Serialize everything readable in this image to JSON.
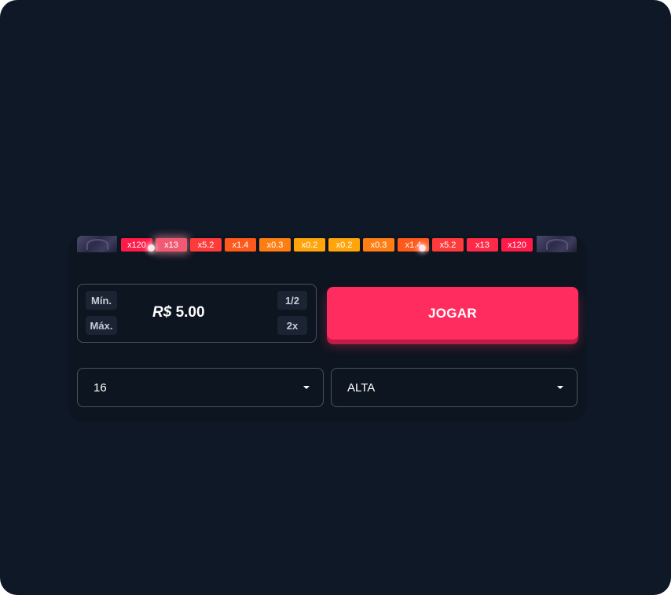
{
  "multipliers": [
    {
      "label": "x120",
      "color": "#ff1a48"
    },
    {
      "label": "x13",
      "color": "#f25a74"
    },
    {
      "label": "x5.2",
      "color": "#ff3a3a"
    },
    {
      "label": "x1.4",
      "color": "#ff5a1c"
    },
    {
      "label": "x0.3",
      "color": "#ff7e14"
    },
    {
      "label": "x0.2",
      "color": "#ffa40a"
    },
    {
      "label": "x0.2",
      "color": "#ffa40a"
    },
    {
      "label": "x0.3",
      "color": "#ff7e14"
    },
    {
      "label": "x1.4",
      "color": "#ff5a1c"
    },
    {
      "label": "x5.2",
      "color": "#ff3a3a"
    },
    {
      "label": "x13",
      "color": "#ff2a48"
    },
    {
      "label": "x120",
      "color": "#ff1a48"
    }
  ],
  "bet": {
    "min_label": "Mín.",
    "max_label": "Máx.",
    "half_label": "1/2",
    "double_label": "2x",
    "currency": "R$",
    "amount": "5.00"
  },
  "play_button": {
    "label": "JOGAR",
    "color": "#ff2d5f"
  },
  "rows_select": {
    "value": "16"
  },
  "risk_select": {
    "value": "ALTA"
  }
}
